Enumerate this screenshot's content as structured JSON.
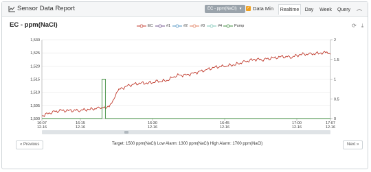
{
  "header": {
    "title": "Sensor Data Report",
    "select_value": "EC - ppm(NaCl)",
    "checkbox_label": "Data Min",
    "checkbox_checked": true,
    "tabs": [
      {
        "label": "Realtime",
        "active": true
      },
      {
        "label": "Day",
        "active": false
      },
      {
        "label": "Week",
        "active": false
      },
      {
        "label": "Query",
        "active": false
      }
    ]
  },
  "chart_title": "EC - ppm(NaCl)",
  "chart_data": {
    "type": "line",
    "legend": [
      "EC",
      "#1",
      "#2",
      "#3",
      "#4",
      "Pump"
    ],
    "legend_colors": [
      "#c0392b",
      "#6b4d8a",
      "#4a90c2",
      "#e07b5a",
      "#7bc4b4",
      "#3a8a3a"
    ],
    "x_ticks": [
      {
        "time": "16:07",
        "date": "12-16"
      },
      {
        "time": "16:15",
        "date": "12-16"
      },
      {
        "time": "16:30",
        "date": "12-16"
      },
      {
        "time": "16:45",
        "date": "12-16"
      },
      {
        "time": "17:00",
        "date": "12-16"
      },
      {
        "time": "17:07",
        "date": "12-16"
      }
    ],
    "x_tick_minutes": [
      0,
      8,
      23,
      38,
      53,
      60
    ],
    "y_left_ticks": [
      "1,530",
      "1,525",
      "1,520",
      "1,515",
      "1,510",
      "1,505",
      "1,500"
    ],
    "y_left_range": [
      1500,
      1530
    ],
    "y_right_ticks": [
      "2",
      "1.5",
      "1",
      "0.5",
      "0"
    ],
    "y_right_range": [
      0,
      2
    ],
    "series": [
      {
        "name": "EC",
        "axis": "left",
        "x_minutes": [
          0,
          2,
          4,
          6,
          8,
          10,
          12,
          13,
          13.5,
          14,
          15,
          16,
          18,
          20,
          22,
          24,
          26,
          28,
          30,
          32,
          34,
          36,
          38,
          40,
          42,
          44,
          46,
          48,
          50,
          52,
          54,
          56,
          58,
          59,
          60
        ],
        "values": [
          1501,
          1502.5,
          1503,
          1503,
          1503.2,
          1503.5,
          1504,
          1504.5,
          1504,
          1504.5,
          1508,
          1511,
          1512.5,
          1513.5,
          1513.5,
          1514,
          1514.5,
          1516.5,
          1516.5,
          1517.5,
          1518.5,
          1519.5,
          1520,
          1520.5,
          1521.5,
          1522.5,
          1522.5,
          1523,
          1523.5,
          1523.5,
          1524.5,
          1524.5,
          1525,
          1525,
          1524.5
        ]
      },
      {
        "name": "Pump",
        "axis": "right",
        "x_minutes": [
          0,
          12.5,
          12.5,
          13.2,
          13.2,
          60
        ],
        "values": [
          0,
          0,
          1,
          1,
          0,
          0
        ]
      }
    ]
  },
  "navigation": {
    "prev_label": "« Previous",
    "next_label": "Next »",
    "info": "Target: 1500 ppm(NaCl)  Low Alarm: 1300 ppm(NaCl)  High Alarm: 1700 ppm(NaCl)"
  }
}
